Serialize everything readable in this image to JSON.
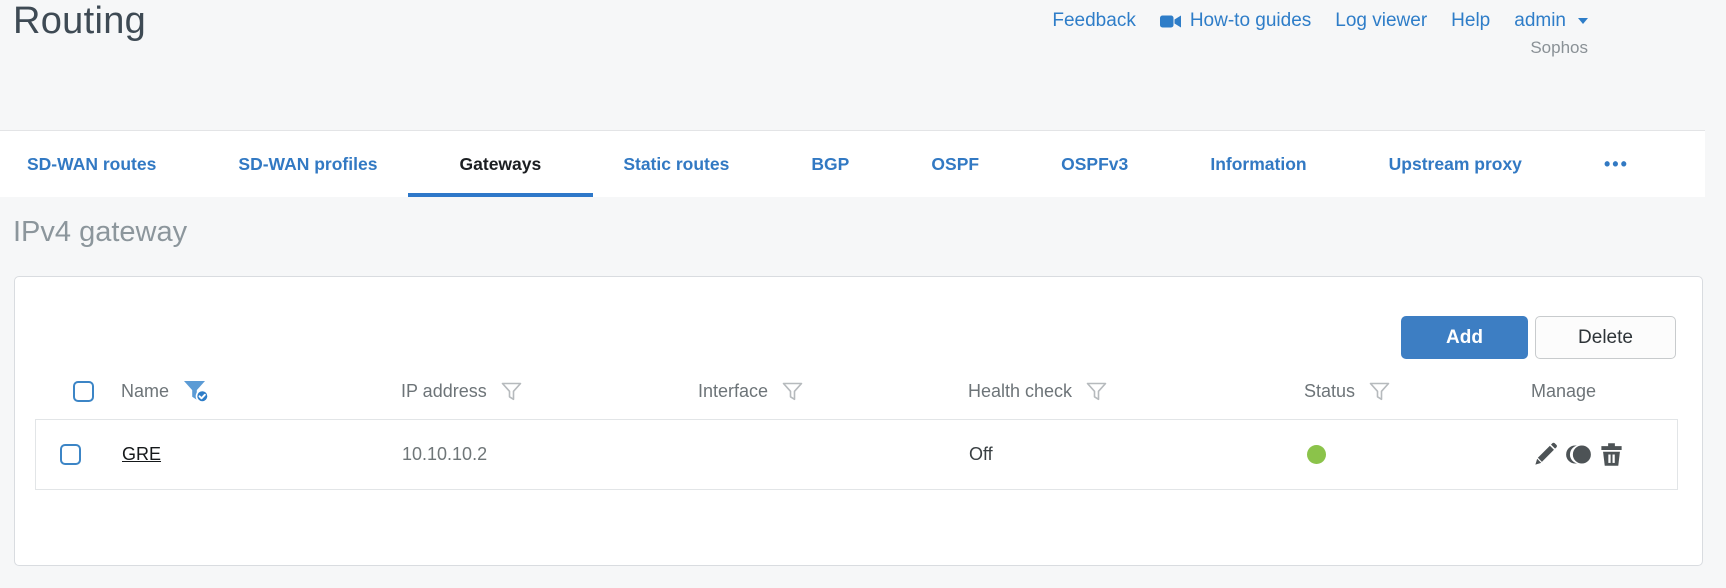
{
  "page": {
    "title": "Routing",
    "brand": "Sophos",
    "section_title": "IPv4 gateway"
  },
  "header_links": {
    "feedback": "Feedback",
    "howto_guides": "How-to guides",
    "log_viewer": "Log viewer",
    "help": "Help",
    "user": "admin"
  },
  "tabs": [
    {
      "label": "SD-WAN routes",
      "active": false
    },
    {
      "label": "SD-WAN profiles",
      "active": false
    },
    {
      "label": "Gateways",
      "active": true
    },
    {
      "label": "Static routes",
      "active": false
    },
    {
      "label": "BGP",
      "active": false
    },
    {
      "label": "OSPF",
      "active": false
    },
    {
      "label": "OSPFv3",
      "active": false
    },
    {
      "label": "Information",
      "active": false
    },
    {
      "label": "Upstream proxy",
      "active": false
    },
    {
      "label": "•••",
      "active": false
    }
  ],
  "toolbar": {
    "add_label": "Add",
    "delete_label": "Delete"
  },
  "table": {
    "columns": [
      {
        "label": "Name",
        "filter": "active"
      },
      {
        "label": "IP address",
        "filter": "inactive"
      },
      {
        "label": "Interface",
        "filter": "inactive"
      },
      {
        "label": "Health check",
        "filter": "inactive"
      },
      {
        "label": "Status",
        "filter": "inactive"
      },
      {
        "label": "Manage",
        "filter": "none"
      }
    ],
    "rows": [
      {
        "name": "GRE",
        "ip_address": "10.10.10.2",
        "interface": "",
        "health_check": "Off",
        "status": "up",
        "manage_icons": [
          "edit",
          "clone",
          "delete"
        ]
      }
    ]
  },
  "colors": {
    "accent_blue": "#2e7dc8",
    "status_green": "#8bc34a"
  }
}
